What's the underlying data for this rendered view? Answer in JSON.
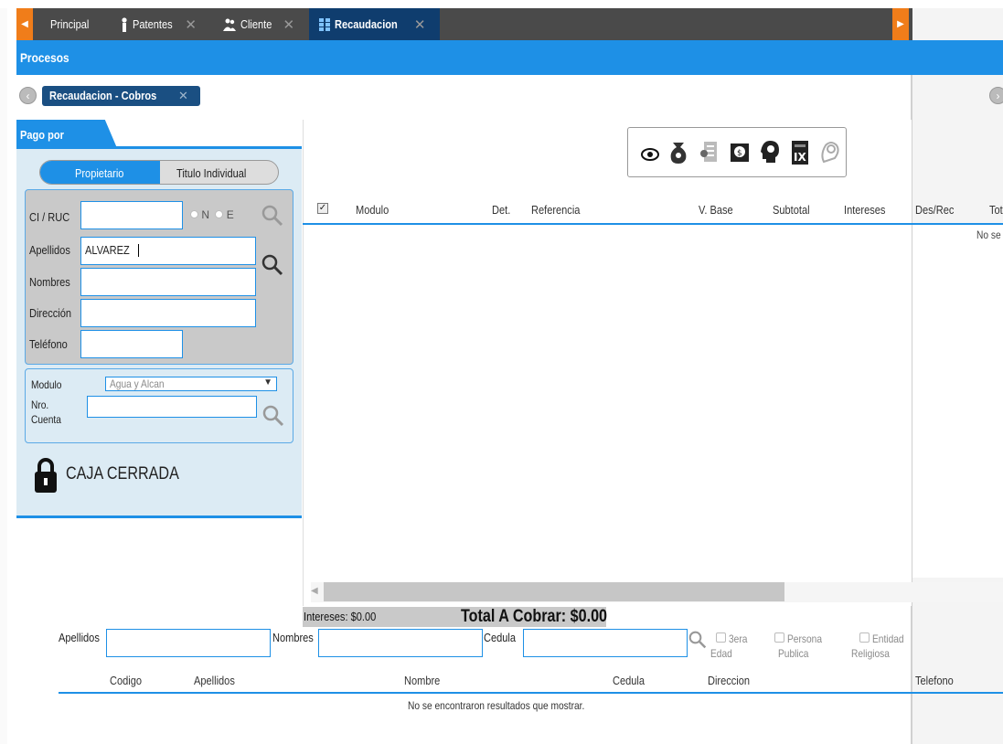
{
  "tabs": [
    {
      "label": "Principal",
      "icon": "home-icon"
    },
    {
      "label": "Patentes",
      "icon": "person-icon"
    },
    {
      "label": "Cliente",
      "icon": "users-icon"
    },
    {
      "label": "Recaudacion",
      "icon": "ledger-icon",
      "active": true
    }
  ],
  "procesos_label": "Procesos",
  "breadcrumb": "Recaudacion - Cobros",
  "left": {
    "section_title": "Pago por",
    "segment": {
      "selected": "Propietario",
      "other": "Titulo Individual"
    },
    "ci_label": "CI / RUC",
    "ci_value": "",
    "radio_n": "N",
    "radio_e": "E",
    "apellidos_label": "Apellidos",
    "apellidos_value": "ALVAREZ",
    "nombres_label": "Nombres",
    "direccion_label": "Dirección",
    "telefono_label": "Teléfono",
    "modulo_label": "Modulo",
    "modulo_value": "Agua y Alcan",
    "nro_label": "Nro.",
    "cuenta_label": "Cuenta",
    "caja_status": "CAJA CERRADA"
  },
  "grid": {
    "columns": [
      "Modulo",
      "Det.",
      "Referencia",
      "V. Base",
      "Subtotal",
      "Intereses",
      "Des/Rec",
      "Tot"
    ],
    "empty_text": "No se",
    "intereses_label": "Intereses: $0.00",
    "total_label": "Total A Cobrar: $0.00"
  },
  "bottom": {
    "apellidos_label": "Apellidos",
    "nombres_label": "Nombres",
    "cedula_label": "Cedula",
    "check_3era": "3era",
    "check_3era_2": "Edad",
    "check_persona": "Persona",
    "check_persona_2": "Publica",
    "check_entidad": "Entidad",
    "check_entidad_2": "Religiosa",
    "columns": [
      "Codigo",
      "Apellidos",
      "Nombre",
      "Cedula",
      "Direccion",
      "Telefono"
    ],
    "empty_text": "No se encontraron resultados que mostrar."
  },
  "colors": {
    "accent": "#1e90e6",
    "dark_tab": "#0f3d6e",
    "orange": "#f07d1a"
  }
}
